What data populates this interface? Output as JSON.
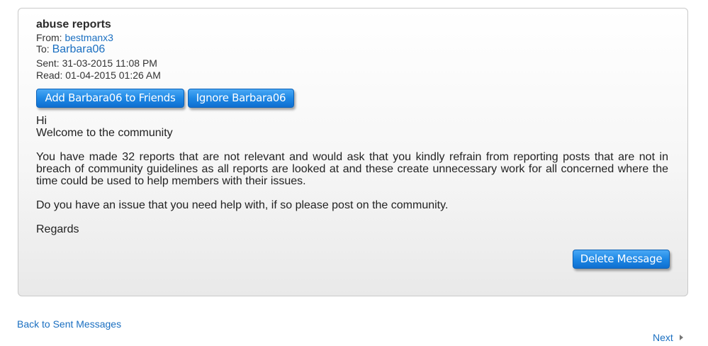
{
  "message": {
    "subject": "abuse reports",
    "from_label": "From:",
    "from_user": "bestmanx3",
    "to_label": "To:",
    "to_user": "Barbara06",
    "sent": "Sent: 31-03-2015 11:08 PM",
    "read": "Read: 01-04-2015 01:26 AM",
    "body": {
      "greeting": "Hi",
      "welcome": "Welcome to the community",
      "paragraph1": "You have made 32 reports that are not relevant and would ask that you kindly refrain from reporting posts that are not in breach of community guidelines as all reports are looked at and these create unnecessary work for all concerned where the time could be used to help members with their issues.",
      "paragraph2": "Do you have an issue that you need help with, if so please post on the community.",
      "signoff": "Regards"
    }
  },
  "actions": {
    "add_friend": "Add Barbara06 to Friends",
    "ignore": "Ignore Barbara06",
    "delete": "Delete Message"
  },
  "nav": {
    "back": "Back to Sent Messages",
    "next": "Next",
    "next_icon": "chevron-right-icon"
  },
  "colors": {
    "link": "#1a6fc1",
    "button": "#1e88e5"
  }
}
